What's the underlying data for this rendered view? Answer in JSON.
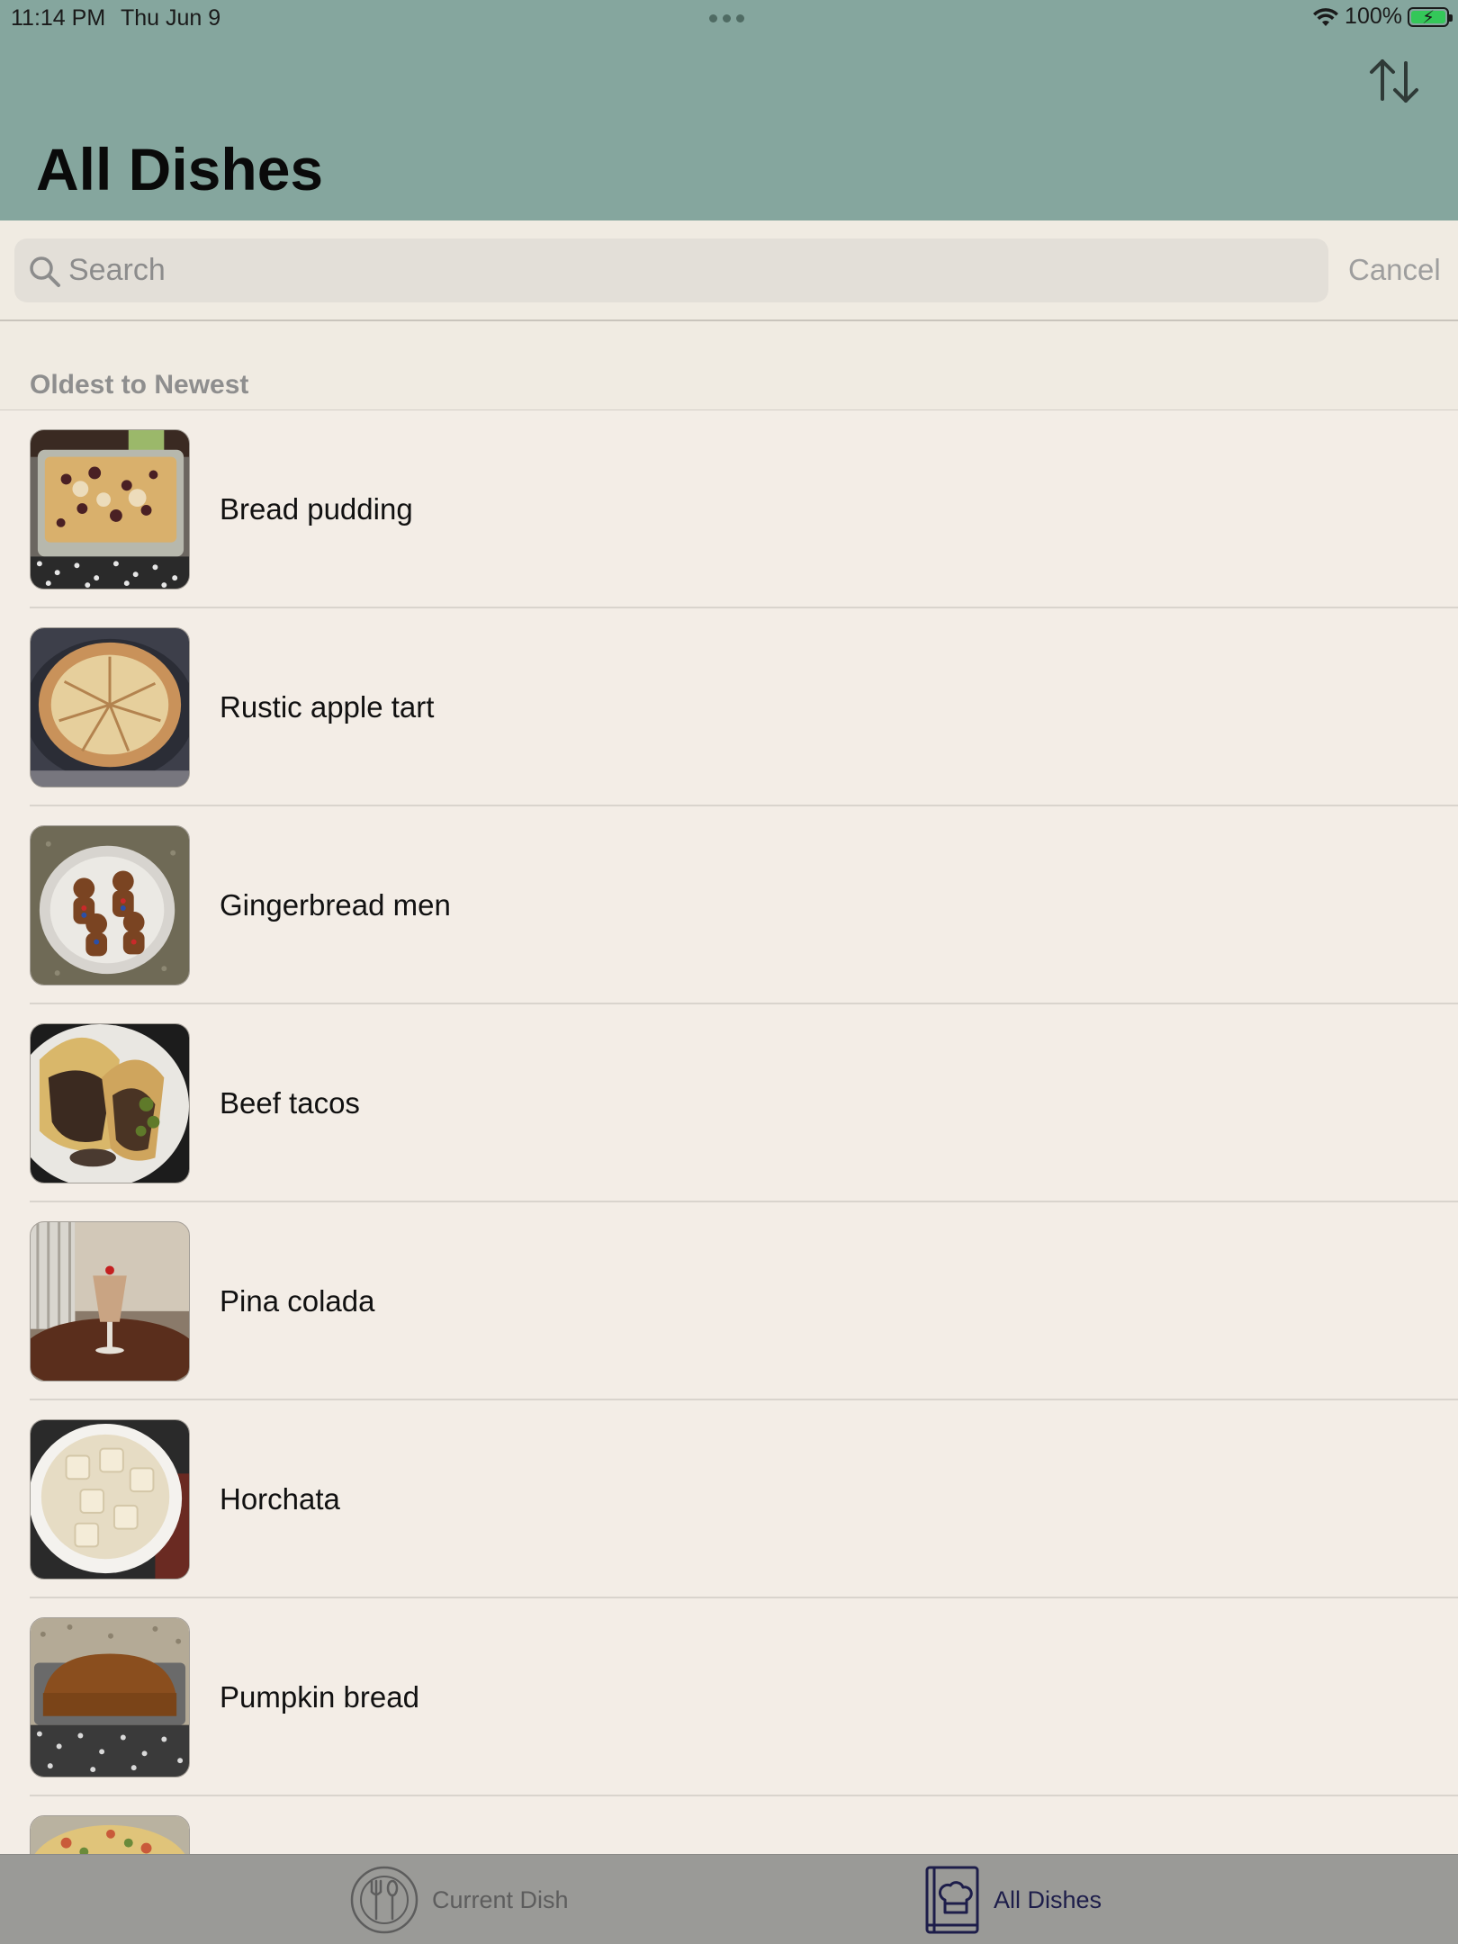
{
  "status_bar": {
    "time": "11:14 PM",
    "date": "Thu Jun 9",
    "battery_percent": "100%",
    "battery_level": 1.0,
    "charging": true
  },
  "header": {
    "title": "All Dishes",
    "sort_icon": "sort-arrows-icon",
    "background": "#85a69e"
  },
  "search": {
    "placeholder": "Search",
    "value": "",
    "cancel_label": "Cancel"
  },
  "section": {
    "label": "Oldest to Newest"
  },
  "dishes": [
    {
      "name": "Bread pudding",
      "photo": "bread-pudding-photo"
    },
    {
      "name": "Rustic apple tart",
      "photo": "apple-tart-photo"
    },
    {
      "name": "Gingerbread men",
      "photo": "gingerbread-photo"
    },
    {
      "name": "Beef tacos",
      "photo": "tacos-photo"
    },
    {
      "name": "Pina colada",
      "photo": "pina-colada-photo"
    },
    {
      "name": "Horchata",
      "photo": "horchata-photo"
    },
    {
      "name": "Pumpkin bread",
      "photo": "pumpkin-bread-photo"
    },
    {
      "name": "",
      "photo": "partial-dish-photo"
    }
  ],
  "tab_bar": {
    "tabs": [
      {
        "label": "Current Dish",
        "icon": "plate-utensils-icon",
        "selected": false
      },
      {
        "label": "All Dishes",
        "icon": "recipe-book-icon",
        "selected": true
      }
    ]
  },
  "colors": {
    "accent_selected_tab": "#1d1d4a",
    "list_background": "#f3ede6",
    "battery_green": "#34c759"
  }
}
